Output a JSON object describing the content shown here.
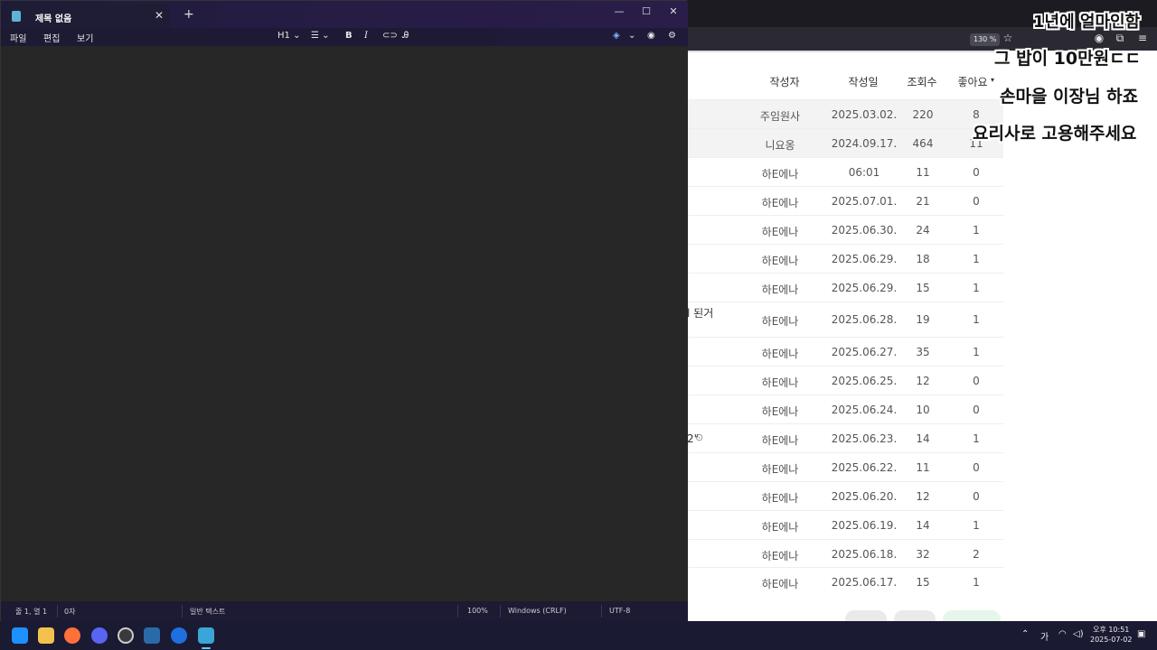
{
  "notepad": {
    "tab_title": "제목 없음",
    "menus": [
      "파일",
      "편집",
      "보기"
    ],
    "toolbar": {
      "heading": "H1",
      "heading_chevron": "⌄",
      "list_chevron": "⌄",
      "bold": "B",
      "italic": "I"
    },
    "status": {
      "position": "줄 1, 열 1",
      "chars": "0자",
      "format": "일반 텍스트",
      "zoom": "100%",
      "line_ending": "Windows (CRLF)",
      "encoding": "UTF-8"
    }
  },
  "browser": {
    "zoom": "130 %",
    "table": {
      "headers": {
        "author": "작성자",
        "date": "작성일",
        "views": "조회수",
        "likes": "좋아요"
      },
      "rows": [
        {
          "author": "주임원사",
          "date": "2025.03.02.",
          "views": "220",
          "likes": "8"
        },
        {
          "author": "니요옹",
          "date": "2024.09.17.",
          "views": "464",
          "likes": "11"
        },
        {
          "author": "하E에나",
          "date": "06:01",
          "views": "11",
          "likes": "0"
        },
        {
          "author": "하E에나",
          "date": "2025.07.01.",
          "views": "21",
          "likes": "0"
        },
        {
          "author": "하E에나",
          "date": "2025.06.30.",
          "views": "24",
          "likes": "1"
        },
        {
          "author": "하E에나",
          "date": "2025.06.29.",
          "views": "18",
          "likes": "1"
        },
        {
          "author": "하E에나",
          "date": "2025.06.29.",
          "views": "15",
          "likes": "1"
        },
        {
          "author": "하E에나",
          "date": "2025.06.28.",
          "views": "19",
          "likes": "1"
        },
        {
          "author": "하E에나",
          "date": "2025.06.27.",
          "views": "35",
          "likes": "1"
        },
        {
          "author": "하E에나",
          "date": "2025.06.25.",
          "views": "12",
          "likes": "0"
        },
        {
          "author": "하E에나",
          "date": "2025.06.24.",
          "views": "10",
          "likes": "0"
        },
        {
          "author": "하E에나",
          "date": "2025.06.23.",
          "views": "14",
          "likes": "1"
        },
        {
          "author": "하E에나",
          "date": "2025.06.22.",
          "views": "11",
          "likes": "0"
        },
        {
          "author": "하E에나",
          "date": "2025.06.20.",
          "views": "12",
          "likes": "0"
        },
        {
          "author": "하E에나",
          "date": "2025.06.19.",
          "views": "14",
          "likes": "1"
        },
        {
          "author": "하E에나",
          "date": "2025.06.18.",
          "views": "32",
          "likes": "2"
        },
        {
          "author": "하E에나",
          "date": "2025.06.17.",
          "views": "15",
          "likes": "1"
        }
      ],
      "title_fragment_1": "l 된거",
      "title_fragment_2": "2\""
    },
    "overlay_captions": [
      "1년에 얼마인함",
      "그 밥이 10만원ㄷㄷ",
      "손마을 이장님 하죠",
      "요리사로 고용해주세요"
    ]
  },
  "taskbar": {
    "tray": {
      "ime": "가"
    },
    "clock": {
      "time": "오후 10:51",
      "date": "2025-07-02"
    }
  }
}
